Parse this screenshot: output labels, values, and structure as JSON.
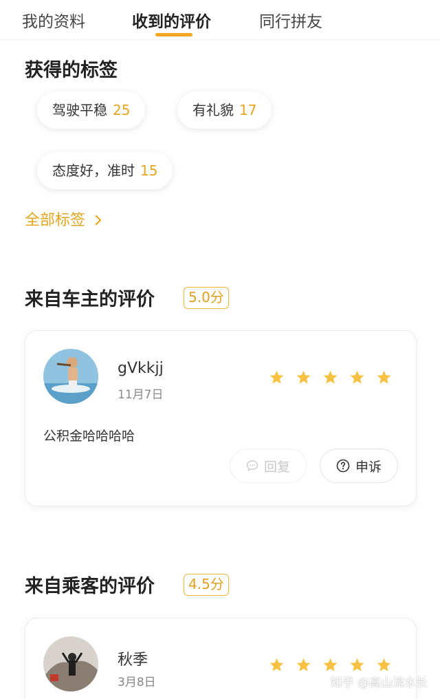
{
  "tabs": [
    {
      "label": "我的资料"
    },
    {
      "label": "收到的评价"
    },
    {
      "label": "同行拼友"
    }
  ],
  "tags_section": {
    "title": "获得的标签",
    "tags": [
      {
        "label": "驾驶平稳",
        "count": "25"
      },
      {
        "label": "有礼貌",
        "count": "17"
      },
      {
        "label": "态度好，准时",
        "count": "15"
      }
    ],
    "all_tags_link": "全部标签"
  },
  "owner_reviews": {
    "title": "来自车主的评价",
    "score": "5.0分",
    "review": {
      "username": "gⅤkkjj",
      "date": "11月7日",
      "rating": 5,
      "comment": "公积金哈哈哈哈",
      "reply_label": "回复",
      "appeal_label": "申诉"
    }
  },
  "passenger_reviews": {
    "title": "来自乘客的评价",
    "score": "4.5分",
    "review": {
      "username": "秋季",
      "date": "3月8日",
      "rating": 5
    }
  },
  "watermark": "知乎 @高山流水长",
  "colors": {
    "accent": "#f5a623",
    "star": "#f7c244",
    "tag_count": "#e6a520"
  }
}
